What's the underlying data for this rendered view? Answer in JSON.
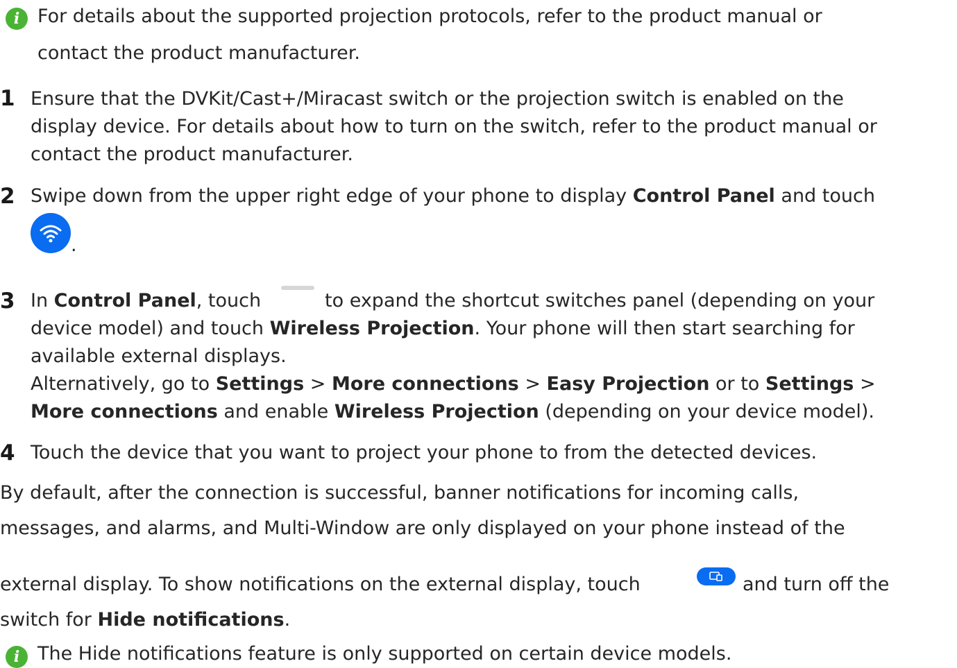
{
  "note1": {
    "line1": "For details about the supported projection protocols, refer to the product manual or",
    "line2": "contact the product manufacturer."
  },
  "step1": {
    "number": "1",
    "line1": "Ensure that the DVKit/Cast+/Miracast switch or the projection switch is enabled on the",
    "line2": "display device. For details about how to turn on the switch, refer to the product manual or",
    "line3": "contact the product manufacturer."
  },
  "step2": {
    "number": "2",
    "text_a": "Swipe down from the upper right edge of your phone to display ",
    "bold_a": "Control Panel",
    "text_b": " and touch",
    "period": ".",
    "icon": "wifi-icon"
  },
  "step3": {
    "number": "3",
    "l1_a": "In ",
    "l1_bold": "Control Panel",
    "l1_b": ", touch",
    "l1_c": "to expand the shortcut switches panel (depending on your",
    "l2_a": "device model) and touch ",
    "l2_bold": "Wireless Projection",
    "l2_b": ". Your phone will then start searching for",
    "l3": "available external displays.",
    "l4_a": "Alternatively, go to ",
    "l4_b1": "Settings",
    "l4_s1": " > ",
    "l4_b2": "More connections",
    "l4_s2": " > ",
    "l4_b3": "Easy Projection",
    "l4_s3": " or to ",
    "l4_b4": "Settings",
    "l4_s4": " >",
    "l5_b1": "More connections",
    "l5_s1": " and enable ",
    "l5_b2": "Wireless Projection",
    "l5_s2": " (depending on your device model)."
  },
  "step4": {
    "number": "4",
    "text": "Touch the device that you want to project your phone to from the detected devices."
  },
  "para": {
    "line1": "By default, after the connection is successful, banner notifications for incoming calls,",
    "line2": "messages, and alarms, and Multi-Window are only displayed on your phone instead of the",
    "line3_a": "external display. To show notifications on the external display, touch",
    "line3_b": "and turn off the",
    "line4_a": "switch for ",
    "line4_bold": "Hide notifications",
    "line4_b": "."
  },
  "note2": {
    "text": "The Hide notifications feature is only supported on certain device models."
  },
  "colors": {
    "note_icon": "#4ab335",
    "accent_blue": "#0a6cf0"
  }
}
